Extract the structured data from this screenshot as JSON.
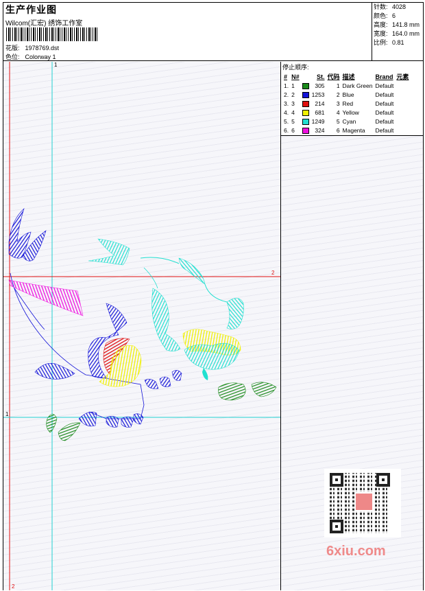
{
  "header": {
    "title": "生产作业图",
    "studio": "Wilcom(汇宏) 绣饰工作室",
    "file_label": "花版:",
    "file_value": "1978769.dst",
    "colorway_label": "色位:",
    "colorway_value": "Colorway 1"
  },
  "stats": {
    "stitches_label": "针数:",
    "stitches_value": "4028",
    "colors_label": "颜色:",
    "colors_value": "6",
    "height_label": "高度:",
    "height_value": "141.8 mm",
    "width_label": "宽度:",
    "width_value": "164.0 mm",
    "scale_label": "比例:",
    "scale_value": "0.81"
  },
  "sequence": {
    "title": "停止顺序:",
    "headers": [
      "#",
      "N#",
      "St.",
      "代码",
      "描述",
      "Brand",
      "元素"
    ],
    "rows": [
      {
        "idx": "1.",
        "n": "1",
        "color": "#1a8a1a",
        "st": "305",
        "code": "1",
        "desc": "Dark Green",
        "brand": "Default"
      },
      {
        "idx": "2.",
        "n": "2",
        "color": "#1414d8",
        "st": "1253",
        "code": "2",
        "desc": "Blue",
        "brand": "Default"
      },
      {
        "idx": "3.",
        "n": "3",
        "color": "#e01010",
        "st": "214",
        "code": "3",
        "desc": "Red",
        "brand": "Default"
      },
      {
        "idx": "4.",
        "n": "4",
        "color": "#f0f000",
        "st": "681",
        "code": "4",
        "desc": "Yellow",
        "brand": "Default"
      },
      {
        "idx": "5.",
        "n": "5",
        "color": "#20e0d0",
        "st": "1249",
        "code": "5",
        "desc": "Cyan",
        "brand": "Default"
      },
      {
        "idx": "6.",
        "n": "6",
        "color": "#f010e0",
        "st": "324",
        "code": "6",
        "desc": "Magenta",
        "brand": "Default"
      }
    ]
  },
  "guides": {
    "v1_top": "1",
    "h2_right": "2",
    "h1_left": "1",
    "v2_bottom": "2"
  },
  "watermark": "6xiu.com",
  "colors": {
    "dark_green": "#1a8a1a",
    "blue": "#1414d8",
    "red": "#e01010",
    "yellow": "#f0f000",
    "cyan": "#20e0d0",
    "magenta": "#f010e0",
    "guide_red": "#e01010",
    "guide_cyan": "#20d0d0"
  }
}
